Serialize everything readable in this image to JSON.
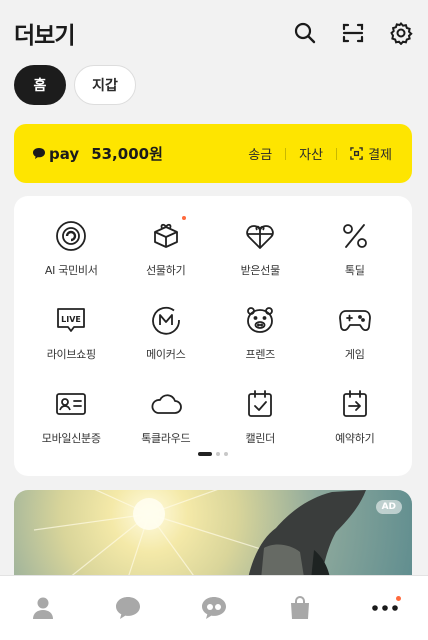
{
  "header": {
    "title": "더보기",
    "icons": [
      "search-icon",
      "scan-icon",
      "gear-icon"
    ]
  },
  "tabs": [
    {
      "label": "홈",
      "active": true
    },
    {
      "label": "지갑",
      "active": false
    }
  ],
  "pay": {
    "logo_text": "pay",
    "balance": "53,000원",
    "actions": [
      {
        "label": "송금"
      },
      {
        "label": "자산"
      },
      {
        "label": "결제",
        "icon": "scan-pay-icon"
      }
    ],
    "bg_color": "#fee500"
  },
  "menu": {
    "items": [
      {
        "label": "AI 국민비서",
        "icon": "ai-assistant-icon"
      },
      {
        "label": "선물하기",
        "icon": "gift-box-icon",
        "new": true
      },
      {
        "label": "받은선물",
        "icon": "heart-gift-icon"
      },
      {
        "label": "톡딜",
        "icon": "discount-icon"
      },
      {
        "label": "라이브쇼핑",
        "icon": "live-icon"
      },
      {
        "label": "메이커스",
        "icon": "makers-icon"
      },
      {
        "label": "프렌즈",
        "icon": "friends-character-icon"
      },
      {
        "label": "게임",
        "icon": "gamepad-icon"
      },
      {
        "label": "모바일신분증",
        "icon": "id-card-icon"
      },
      {
        "label": "톡클라우드",
        "icon": "cloud-icon"
      },
      {
        "label": "캘린더",
        "icon": "calendar-icon"
      },
      {
        "label": "예약하기",
        "icon": "reservation-icon"
      }
    ],
    "pages": 3,
    "current_page": 1
  },
  "ad": {
    "badge": "AD"
  },
  "bottom_nav": {
    "items": [
      "person-icon",
      "chat-icon",
      "openchat-icon",
      "shopping-bag-icon",
      "more-icon"
    ],
    "active_index": 4,
    "accent": "#ff6a3d"
  }
}
